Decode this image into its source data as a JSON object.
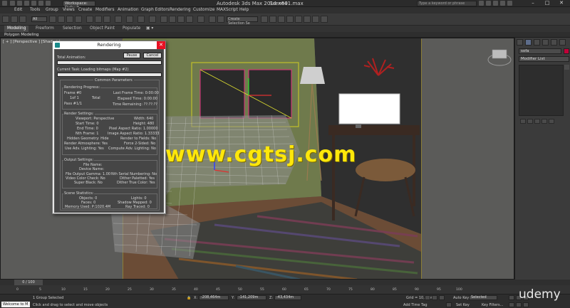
{
  "window": {
    "title": "Autodesk 3ds Max  2014 x64",
    "file": "Scene01.max",
    "workspace": "Workspace: Default",
    "search_placeholder": "Type a keyword or phrase"
  },
  "menu": [
    "Edit",
    "Tools",
    "Group",
    "Views",
    "Create",
    "Modifiers",
    "Animation",
    "Graph Editors",
    "Rendering",
    "Customize",
    "MAXScript",
    "Help"
  ],
  "toolbar": {
    "filter": "All",
    "selection_set": "Create Selection Se"
  },
  "ribbon": {
    "tabs": [
      "Modeling",
      "Freeform",
      "Selection",
      "Object Paint",
      "Populate"
    ],
    "subtitle": "Polygon Modeling"
  },
  "viewport": {
    "label": "[ + ] [Perspective ] [Shaded ]"
  },
  "overlay": {
    "watermark": "www.cgtsj.com",
    "brand": "udemy"
  },
  "command_panel": {
    "object_name": "sofa",
    "modifier_list": "Modifier List"
  },
  "dialog": {
    "title": "Rendering",
    "pause_label": "Pause",
    "cancel_label": "Cancel",
    "total_animation_label": "Total Animation:",
    "current_task_label": "Current Task:",
    "current_task_value": "Loading bitmaps (Map #2)",
    "common_parameters": "Common Parameters",
    "progress_title": "Rendering Progress:",
    "frame_label": "Frame #",
    "frame_value": "0",
    "of_value": "1of 1",
    "total_label": "Total",
    "pass_label": "Pass #",
    "pass_value": "1/1",
    "last_frame_time": "Last Frame Time: 0:00:00",
    "elapsed_time": "Elapsed Time: 0:00:00",
    "time_remaining": "Time Remaining: ??:??:??",
    "render_settings_title": "Render Settings:",
    "render_settings_left": [
      "Viewport: Perspective",
      "Start Time: 0",
      "End Time: 0",
      "Nth Frame: 1",
      "Hidden Geometry: Hide",
      "Render Atmosphere: Yes",
      "Use Adv. Lighting: Yes"
    ],
    "render_settings_right": [
      "Width: 640",
      "Height: 480",
      "Pixel Aspect Ratio: 1.00000",
      "Image Aspect Ratio: 1.33333",
      "Render to Fields: No",
      "Force 2-Sided: No",
      "Compute Adv. Lighting: No"
    ],
    "output_title": "Output Settings:",
    "output_left": [
      "File Name:",
      "Device Name:",
      "File Output Gamma: 1.00",
      "Video Color Check: No",
      "Super Black: No"
    ],
    "output_right": [
      "Nth Serial Numbering: No",
      "Dither Paletted: Yes",
      "Dither True Color: Yes"
    ],
    "scene_title": "Scene Statistics:",
    "scene_left": [
      "Objects: 0",
      "Faces: 0",
      "Memory Used: P:1020.4M"
    ],
    "scene_right": [
      "Lights: 0",
      "Shadow Mapped: 0",
      "Ray Traced: 0"
    ]
  },
  "timeline": {
    "slider": "0 / 100",
    "ticks": [
      "0",
      "5",
      "10",
      "15",
      "20",
      "25",
      "30",
      "35",
      "40",
      "45",
      "50",
      "55",
      "60",
      "65",
      "70",
      "75",
      "80",
      "85",
      "90",
      "95",
      "100"
    ]
  },
  "status": {
    "selected": "1 Group Selected",
    "prompt": "Click and drag to select and move objects",
    "welcome": "Welcome to M",
    "x_label": "X:",
    "x_value": "-208,464m",
    "y_label": "Y:",
    "y_value": "-141,209m",
    "z_label": "Z:",
    "z_value": "-43,434m",
    "grid": "Grid = 10,0cm",
    "add_time_tag": "Add Time Tag",
    "auto_key": "Auto Key",
    "auto_key_value": "Selected",
    "set_key": "Set Key",
    "key_filters": "Key Filters..."
  }
}
